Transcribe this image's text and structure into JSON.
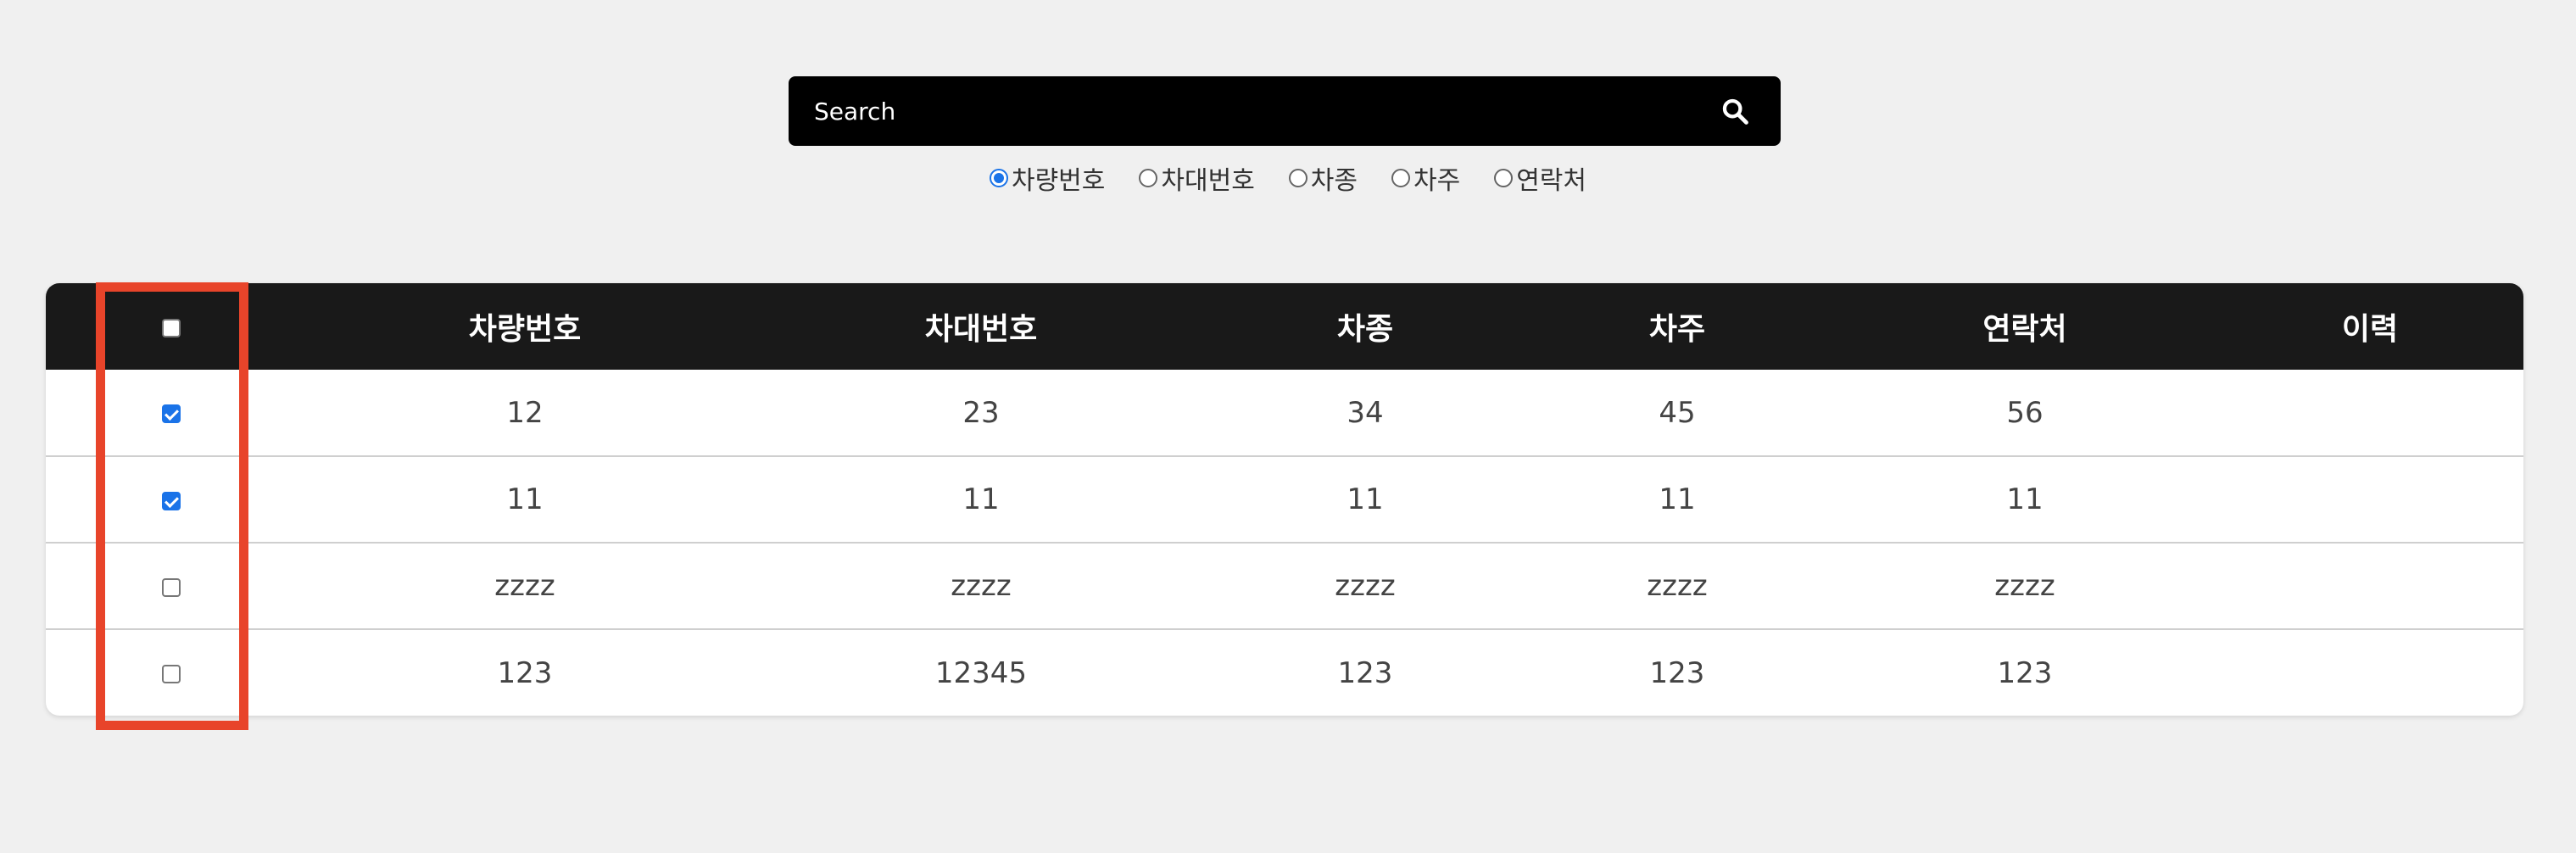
{
  "search": {
    "placeholder": "Search"
  },
  "search_options": [
    {
      "label": "차량번호",
      "checked": true
    },
    {
      "label": "차대번호",
      "checked": false
    },
    {
      "label": "차종",
      "checked": false
    },
    {
      "label": "차주",
      "checked": false
    },
    {
      "label": "연락처",
      "checked": false
    }
  ],
  "table": {
    "headers": [
      "차량번호",
      "차대번호",
      "차종",
      "차주",
      "연락처",
      "이력"
    ],
    "select_all_checked": false,
    "rows": [
      {
        "checked": true,
        "cells": [
          "12",
          "23",
          "34",
          "45",
          "56",
          ""
        ]
      },
      {
        "checked": true,
        "cells": [
          "11",
          "11",
          "11",
          "11",
          "11",
          ""
        ]
      },
      {
        "checked": false,
        "cells": [
          "zzzz",
          "zzzz",
          "zzzz",
          "zzzz",
          "zzzz",
          ""
        ]
      },
      {
        "checked": false,
        "cells": [
          "123",
          "12345",
          "123",
          "123",
          "123",
          ""
        ]
      }
    ]
  },
  "colors": {
    "header_bg": "#191919",
    "search_bg": "#000000",
    "accent": "#1a73e8",
    "highlight": "#e8442a"
  },
  "icons": {
    "search": "search-icon"
  }
}
